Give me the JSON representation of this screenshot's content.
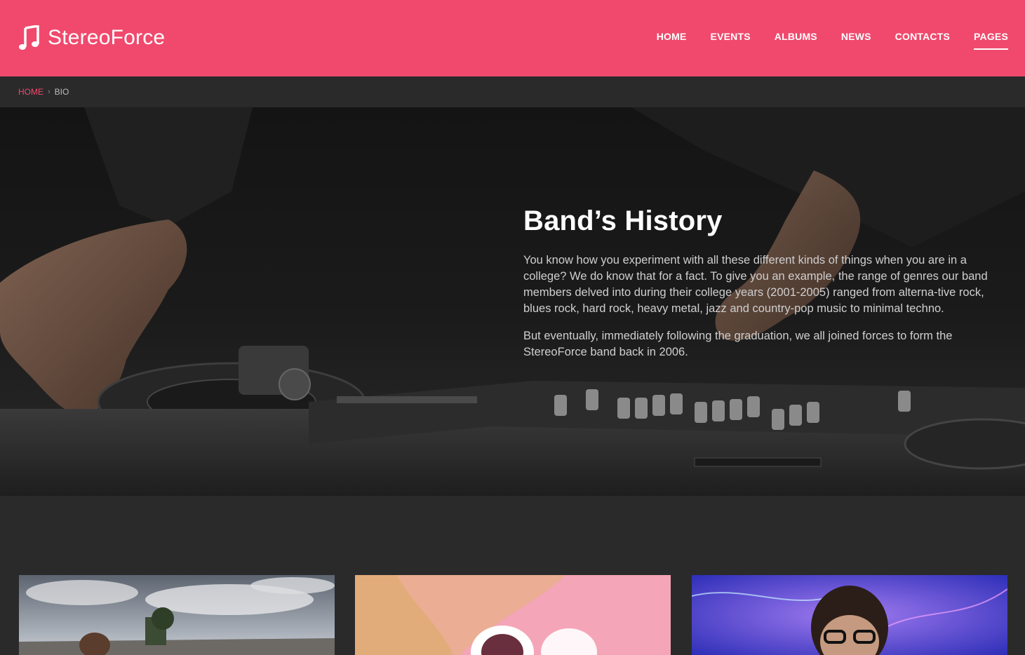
{
  "brand": {
    "name": "StereoForce",
    "icon": "music-note-icon"
  },
  "nav": {
    "items": [
      {
        "label": "HOME",
        "active": false
      },
      {
        "label": "EVENTS",
        "active": false
      },
      {
        "label": "ALBUMS",
        "active": false
      },
      {
        "label": "NEWS",
        "active": false
      },
      {
        "label": "CONTACTS",
        "active": false
      },
      {
        "label": "PAGES",
        "active": true
      }
    ]
  },
  "breadcrumb": {
    "home": "HOME",
    "separator": "›",
    "current": "BIO"
  },
  "hero": {
    "title": "Band’s History",
    "paragraphs": [
      "You know how you experiment with all these different kinds of things when you are in a college? We do know that for a fact. To give you an example, the range of genres our band members delved into during their college years (2001-2005) ranged from alterna-tive rock, blues rock, hard rock, heavy metal, jazz and country-pop music to minimal techno.",
      "But eventually, immediately following the graduation, we all joined forces to form the StereoForce band back in 2006."
    ]
  },
  "colors": {
    "accent": "#f0496d",
    "background": "#2a2a2b",
    "hero_text": "#cfcfcf"
  }
}
